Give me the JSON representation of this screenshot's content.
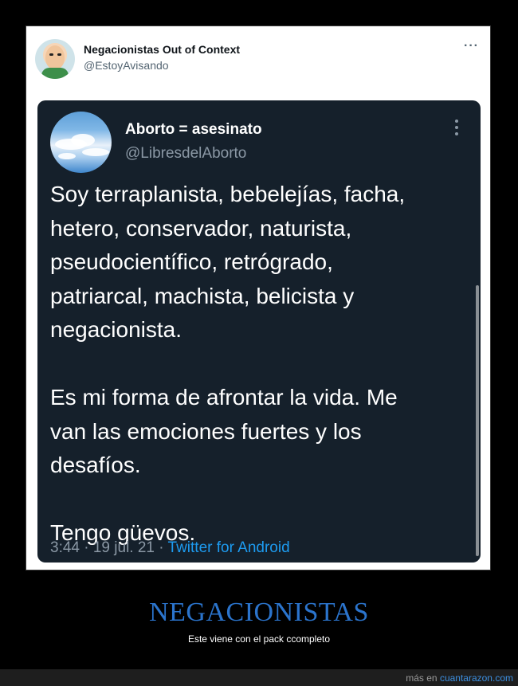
{
  "outer_tweet": {
    "name": "Negacionistas Out of Context",
    "handle": "@EstoyAvisando",
    "more_icon": "more-horizontal-icon"
  },
  "inner_tweet": {
    "name": "Aborto = asesinato",
    "handle": "@LibresdelAborto",
    "more_icon": "more-vertical-icon",
    "text": "Soy terraplanista, bebelejías, facha,\nhetero, conservador, naturista,\npseudocientífico, retrógrado,\npatriarcal, machista, belicista y\nnegacionista.\n\nEs mi forma de afrontar la vida. Me\nvan las emociones fuertes y los\ndesafíos.\n\nTengo güevos.",
    "timestamp": "3:44 · 19 jul. 21 · ",
    "source": "Twitter for Android"
  },
  "caption": {
    "title": "NEGACIONISTAS",
    "subtitle": "Este viene con el pack ccompleto"
  },
  "footer": {
    "prefix": "más en ",
    "site": "cuantarazon.com"
  },
  "colors": {
    "title": "#2b74cc",
    "dark_card": "#15202b",
    "link": "#1d9bf0"
  }
}
